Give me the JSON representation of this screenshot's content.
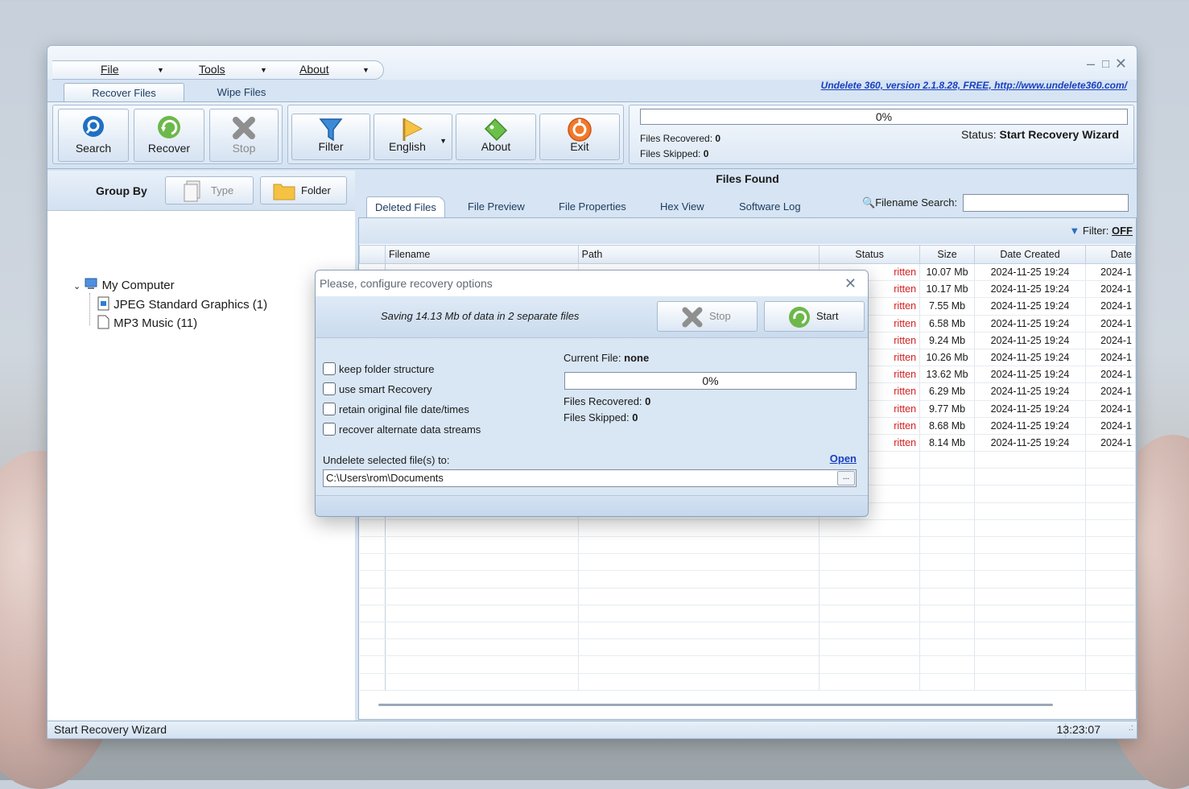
{
  "menu": {
    "file": "File",
    "tools": "Tools",
    "about": "About"
  },
  "window_controls": {
    "minimize": "–",
    "maximize": "□",
    "close": "✕"
  },
  "app_title_link": "Undelete 360, version 2.1.8.28, FREE, http://www.undelete360.com/",
  "ribbon_tabs": [
    "Recover Files",
    "Wipe Files"
  ],
  "toolbar": {
    "search": "Search",
    "recover": "Recover",
    "stop": "Stop",
    "filter": "Filter",
    "english": "English",
    "about": "About",
    "exit": "Exit"
  },
  "progress": {
    "percent": "0%",
    "files_recovered_label": "Files Recovered:",
    "files_recovered": "0",
    "files_skipped_label": "Files Skipped:",
    "files_skipped": "0",
    "status_label": "Status:",
    "status_value": "Start Recovery Wizard"
  },
  "group_by": {
    "label": "Group By",
    "type_btn": "Type",
    "folder_btn": "Folder"
  },
  "tree": {
    "root": "My Computer",
    "items": [
      "JPEG Standard Graphics (1)",
      "MP3 Music (11)"
    ]
  },
  "files_found": {
    "title": "Files Found",
    "tabs": [
      "Deleted Files",
      "File Preview",
      "File Properties",
      "Hex View",
      "Software Log"
    ],
    "search_label": "Filename Search:",
    "filter_label": "Filter:",
    "filter_value": "OFF",
    "columns": [
      "Filename",
      "Path",
      "Status",
      "Size",
      "Date Created",
      "Date"
    ],
    "rows": [
      {
        "status": "ritten",
        "size": "10.07 Mb",
        "created": "2024-11-25 19:24",
        "date": "2024-1"
      },
      {
        "status": "ritten",
        "size": "10.17 Mb",
        "created": "2024-11-25 19:24",
        "date": "2024-1"
      },
      {
        "status": "ritten",
        "size": "7.55 Mb",
        "created": "2024-11-25 19:24",
        "date": "2024-1"
      },
      {
        "status": "ritten",
        "size": "6.58 Mb",
        "created": "2024-11-25 19:24",
        "date": "2024-1"
      },
      {
        "status": "ritten",
        "size": "9.24 Mb",
        "created": "2024-11-25 19:24",
        "date": "2024-1"
      },
      {
        "status": "ritten",
        "size": "10.26 Mb",
        "created": "2024-11-25 19:24",
        "date": "2024-1"
      },
      {
        "status": "ritten",
        "size": "13.62 Mb",
        "created": "2024-11-25 19:24",
        "date": "2024-1"
      },
      {
        "status": "ritten",
        "size": "6.29 Mb",
        "created": "2024-11-25 19:24",
        "date": "2024-1"
      },
      {
        "status": "ritten",
        "size": "9.77 Mb",
        "created": "2024-11-25 19:24",
        "date": "2024-1"
      },
      {
        "status": "ritten",
        "size": "8.68 Mb",
        "created": "2024-11-25 19:24",
        "date": "2024-1"
      },
      {
        "status": "ritten",
        "size": "8.14 Mb",
        "created": "2024-11-25 19:24",
        "date": "2024-1"
      }
    ]
  },
  "statusbar": {
    "left": "Start Recovery Wizard",
    "time": "13:23:07"
  },
  "dialog": {
    "title": "Please, configure recovery options",
    "saving": "Saving 14.13 Mb of data in 2 separate files",
    "stop": "Stop",
    "start": "Start",
    "current_file_label": "Current File:",
    "current_file": "none",
    "percent": "0%",
    "files_recovered_label": "Files Recovered:",
    "files_recovered": "0",
    "files_skipped_label": "Files Skipped:",
    "files_skipped": "0",
    "options": [
      "keep folder structure",
      "use smart Recovery",
      "retain original file date/times",
      "recover alternate data streams"
    ],
    "dest_label": "Undelete selected file(s) to:",
    "open_link": "Open",
    "dest_path": "C:\\Users\\rom\\Documents",
    "browse": "..."
  },
  "colors": {
    "accent_blue": "#1a3fbf",
    "status_red": "#d42020",
    "frame": "#d6e4f3"
  }
}
